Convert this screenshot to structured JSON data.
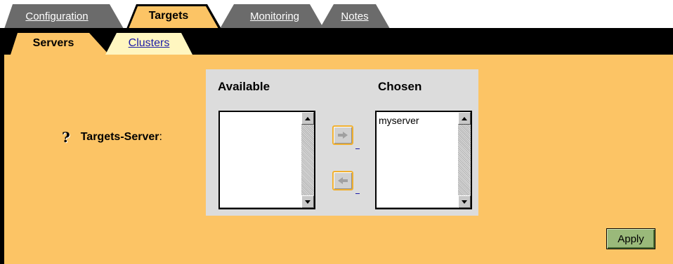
{
  "top_tabs": [
    {
      "label": "Configuration",
      "active": false
    },
    {
      "label": "Targets",
      "active": true
    },
    {
      "label": "Monitoring",
      "active": false
    },
    {
      "label": "Notes",
      "active": false
    }
  ],
  "sub_tabs": [
    {
      "label": "Servers",
      "active": true
    },
    {
      "label": "Clusters",
      "active": false
    }
  ],
  "field": {
    "help_icon": "?",
    "label": "Targets-Server",
    "colon": ":"
  },
  "chooser": {
    "available_heading": "Available",
    "chosen_heading": "Chosen",
    "available_items": [],
    "chosen_items": [
      "myserver"
    ]
  },
  "apply_label": "Apply",
  "colors": {
    "panel": "#fcc465",
    "tab_inactive": "#6b6b6b",
    "tab_active": "#fcc465",
    "subtab_inactive": "#fff6c0"
  }
}
